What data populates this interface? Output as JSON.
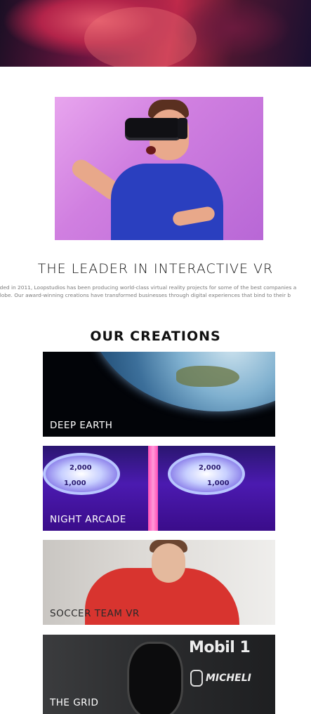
{
  "intro": {
    "title": "THE LEADER IN INTERACTIVE VR",
    "text_line1": "nded in 2011, Loopstudios has been producing world-class virtual reality projects for some of the best companies a",
    "text_line2": "globe. Our award-winning creations have transformed businesses through digital experiences that bind to their b"
  },
  "creations": {
    "title": "OUR CREATIONS",
    "items": [
      {
        "label": "DEEP EARTH"
      },
      {
        "label": "NIGHT ARCADE"
      },
      {
        "label": "SOCCER TEAM VR"
      },
      {
        "label": "THE GRID"
      }
    ]
  },
  "arcade_numbers": [
    "2,000",
    "1,000",
    "2,000",
    "1,000"
  ],
  "grid_brands": {
    "brand1": "Mobil 1",
    "brand2": "MICHELI"
  }
}
